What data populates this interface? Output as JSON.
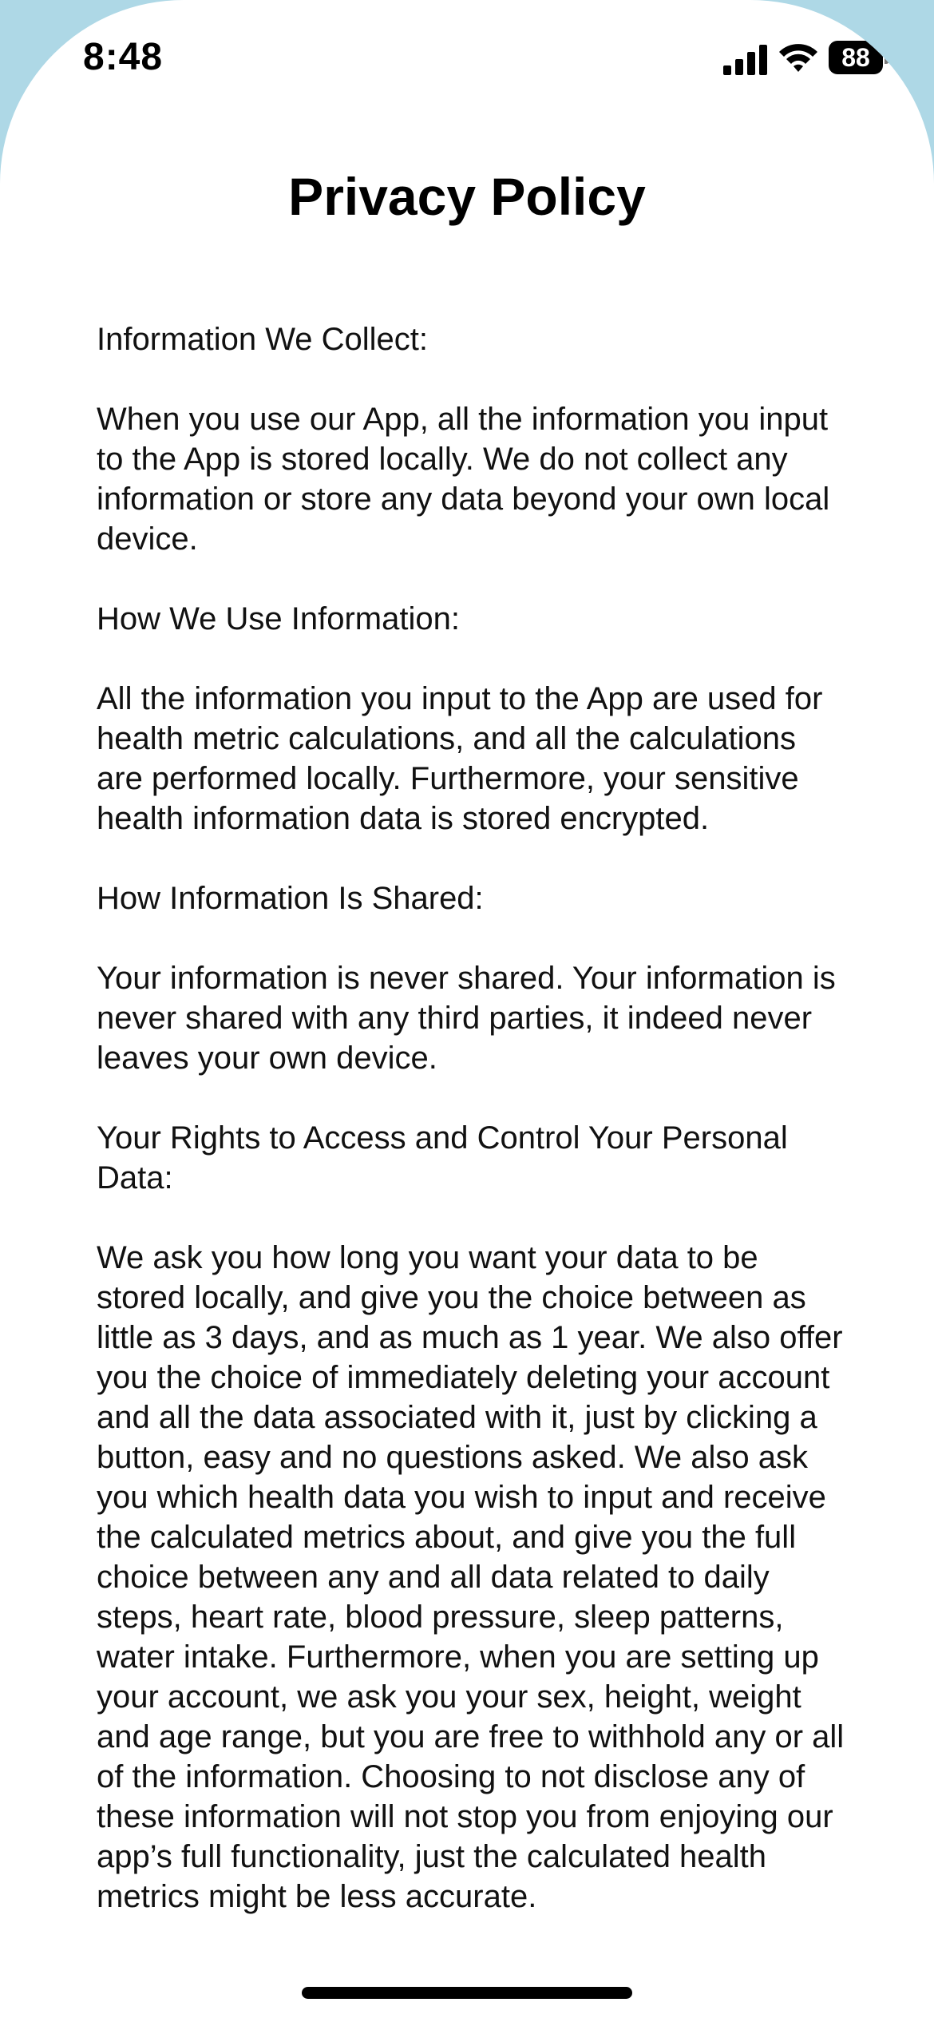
{
  "status_bar": {
    "time": "8:48",
    "battery_level": "88"
  },
  "header": {
    "title": "Privacy Policy"
  },
  "policy": {
    "heading_collect": "Information We Collect:",
    "body_collect": "When you use our App, all the information you input to the App is stored locally. We do not collect any information or store any data beyond your own local device.",
    "heading_use": "How We Use Information:",
    "body_use": "All the information you input to the App are used for health metric calculations, and all the calculations are performed locally. Furthermore, your sensitive health information data is stored encrypted.",
    "heading_shared": "How Information Is Shared:",
    "body_shared": "Your information is never shared. Your information is never shared with any third parties, it indeed never leaves your own device.",
    "heading_rights": "Your Rights to Access and Control Your Personal Data:",
    "body_rights": "We ask you how long you want your data to be stored locally, and give you the choice between as little as 3 days, and as much as 1 year. We also offer you the choice of immediately deleting your account and all the data associated with it, just by clicking a button, easy and no questions asked. We also ask you which health data you wish to input and receive the calculated metrics about, and give you the full choice between any and all data related to daily steps, heart rate, blood pressure, sleep patterns, water intake. Furthermore, when you are setting up your account, we ask you your sex, height, weight and age range, but you are free to withhold any or all of the information. Choosing to not disclose any of these information will not stop you from enjoying our app’s full functionality, just the calculated health metrics might be less accurate."
  },
  "colors": {
    "background_accent": "#aed8e6",
    "sheet": "#ffffff",
    "text": "#111111"
  }
}
